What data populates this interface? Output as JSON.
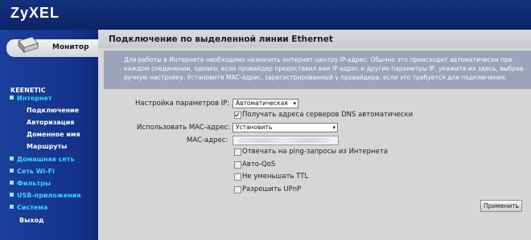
{
  "brand": {
    "logo": "ZyXEL"
  },
  "sidebar": {
    "monitor_tab": "Монитор",
    "product": "KEENETIC",
    "items": [
      {
        "label": "Интернет",
        "expanded": true
      },
      {
        "label": "Домашняя сеть"
      },
      {
        "label": "Сеть Wi-Fi"
      },
      {
        "label": "Фильтры"
      },
      {
        "label": "USB-приложения"
      },
      {
        "label": "Система"
      }
    ],
    "subitems": [
      "Подключение",
      "Авторизация",
      "Доменное имя",
      "Маршруты"
    ],
    "logout": "Выход"
  },
  "main": {
    "title": "Подключение по выделенной линии Ethernet",
    "description": "Для работы в Интернете необходимо назначить интернет-центру IP-адрес. Обычно это происходит автоматически при каждом соединении, однако, если провайдер предоставил вам IP-адрес и другие параметры IP, укажите их здесь, выбрав ручную настройку. Установите MAC-адрес, зарегистрированный у провайдера, если это требуется для подключения.",
    "ip_settings_label": "Настройка параметров IP:",
    "ip_settings_value": "Автоматическая",
    "dns_auto_label": "Получать адреса серверов DNS автоматически",
    "dns_auto_checked": true,
    "use_mac_label": "Использовать MAC-адрес:",
    "use_mac_value": "Установить",
    "mac_label": "MAC-адрес:",
    "options": [
      {
        "label": "Отвечать на ping-запросы из Интернета",
        "checked": false
      },
      {
        "label": "Авто-QoS",
        "checked": false
      },
      {
        "label": "Не уменьшать TTL",
        "checked": false
      },
      {
        "label": "Разрешить UPnP",
        "checked": false
      }
    ],
    "apply_label": "Применить"
  },
  "icons": {
    "monitor": "monitor-icon",
    "expanded_marker": "square-bullet-icon",
    "dropdown": "dropdown-arrow-icon"
  }
}
